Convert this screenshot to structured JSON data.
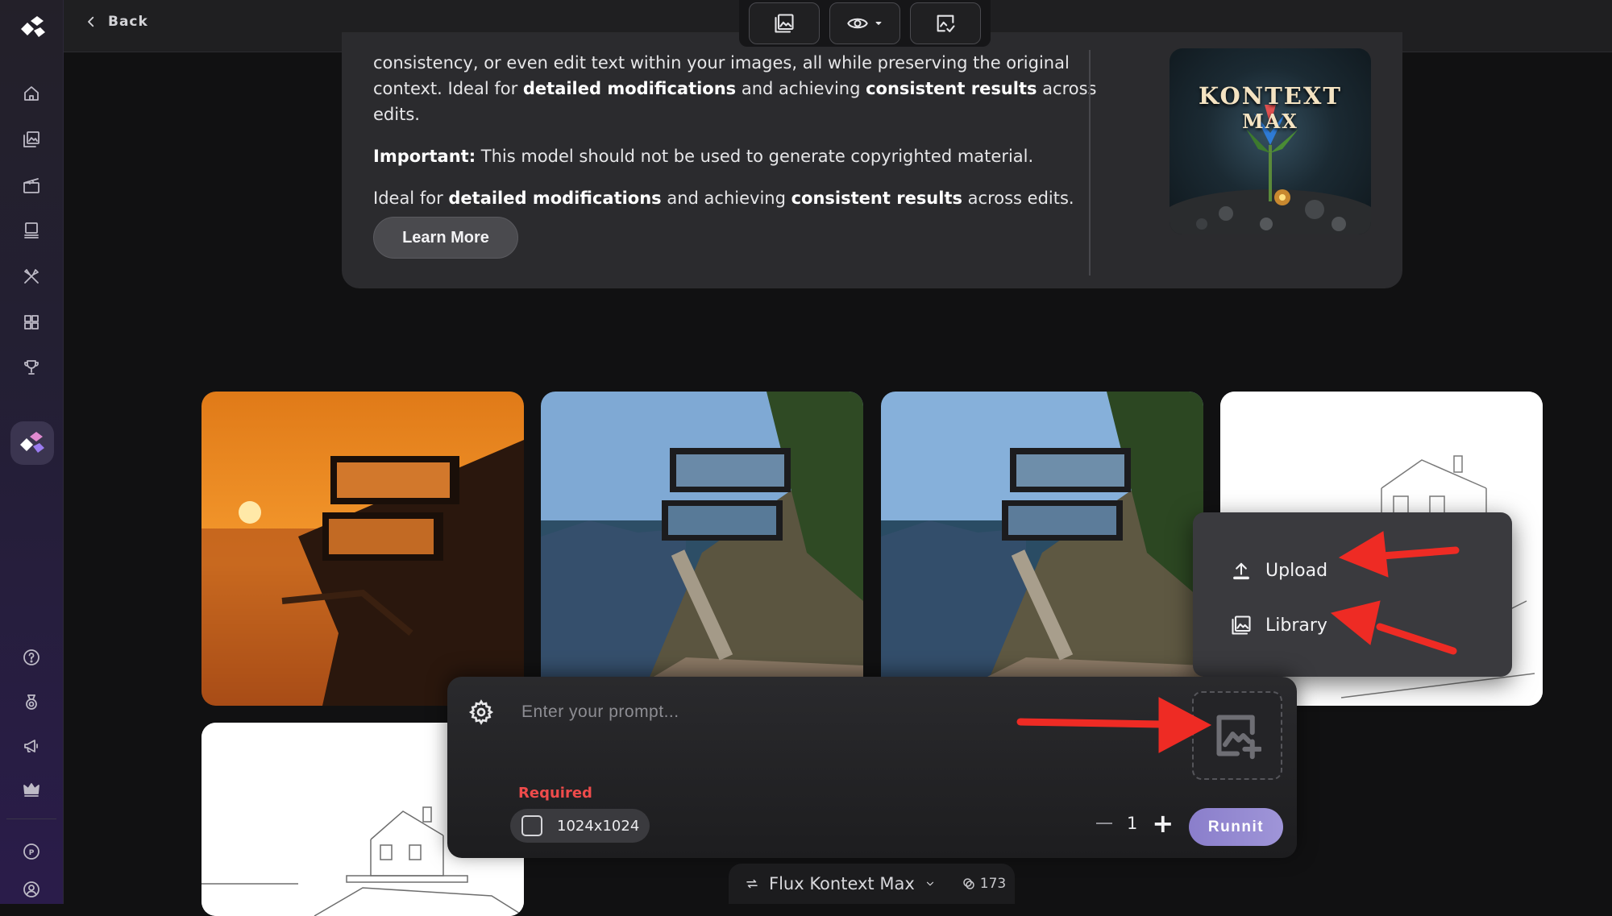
{
  "colors": {
    "accent": "#9f95d8",
    "required": "#ef4b4b",
    "annotation_arrow": "#ee2b24",
    "sidebar_gradient_end": "#2a1c4a"
  },
  "topbar": {
    "back_label": "Back",
    "tools": [
      {
        "name": "gallery-icon"
      },
      {
        "name": "eye-icon"
      },
      {
        "name": "image-check-icon"
      }
    ]
  },
  "sidebar": {
    "items": [
      {
        "name": "home-icon"
      },
      {
        "name": "images-icon"
      },
      {
        "name": "clapperboard-icon"
      },
      {
        "name": "stack-icon"
      },
      {
        "name": "tools-icon"
      },
      {
        "name": "grid-icon"
      },
      {
        "name": "trophy-icon"
      },
      {
        "name": "logo-active-icon"
      },
      {
        "name": "help-icon"
      },
      {
        "name": "badge-icon"
      },
      {
        "name": "megaphone-icon"
      },
      {
        "name": "crown-icon"
      },
      {
        "name": "p-coin-icon"
      },
      {
        "name": "user-icon"
      }
    ]
  },
  "info": {
    "line1": "consistency, or even edit text within your images, all while preserving the original",
    "line2_pre": "context. Ideal for ",
    "line2_b1": "detailed modifications",
    "line2_mid": " and achieving ",
    "line2_b2": "consistent results",
    "line2_post": " across edits.",
    "important_label": "Important:",
    "important_text": " This model should not be used to generate copyrighted material.",
    "ideal_pre": "Ideal for ",
    "ideal_b1": "detailed modifications",
    "ideal_mid": " and achieving ",
    "ideal_b2": "consistent results",
    "ideal_post": " across edits.",
    "learn_more": "Learn More",
    "thumb_line1": "KONTEXT",
    "thumb_line2": "MAX"
  },
  "popup": {
    "upload_label": "Upload",
    "library_label": "Library"
  },
  "prompt": {
    "placeholder": "Enter your prompt...",
    "required_label": "Required",
    "size_label": "1024x1024",
    "count": "1",
    "run_label": "Runnit"
  },
  "model_bar": {
    "model_name": "Flux Kontext Max",
    "credits": "173"
  }
}
